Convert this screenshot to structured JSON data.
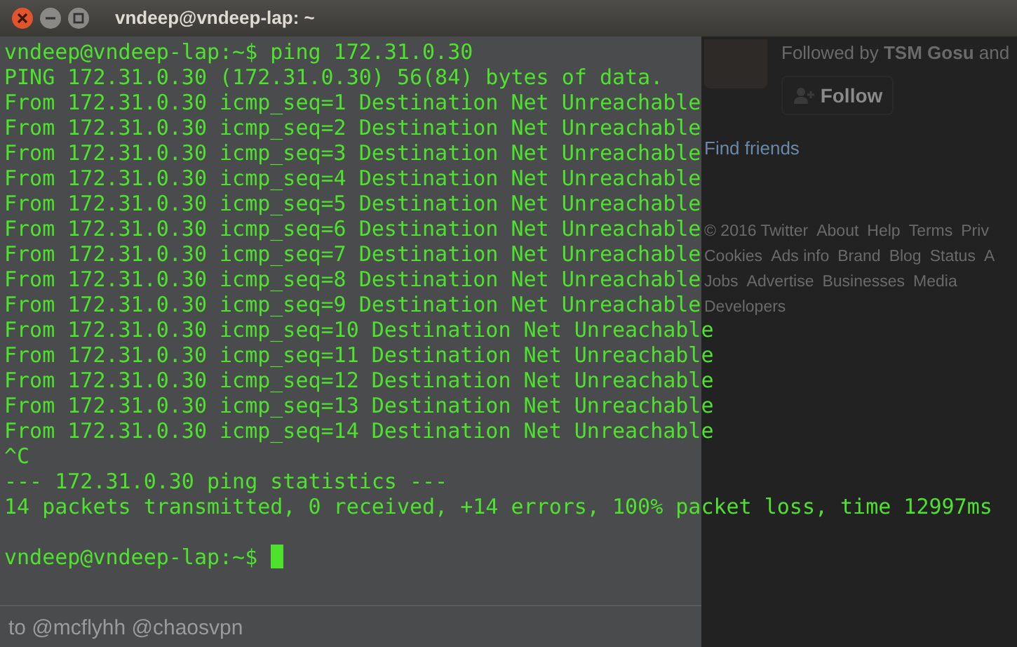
{
  "window": {
    "title": "vndeep@vndeep-lap: ~"
  },
  "terminal": {
    "lines": [
      {
        "kind": "prompt",
        "prompt": "vndeep@vndeep-lap:~$",
        "command": "ping 172.31.0.30",
        "cursor": false
      },
      {
        "kind": "output",
        "text": "PING 172.31.0.30 (172.31.0.30) 56(84) bytes of data."
      },
      {
        "kind": "output",
        "text": "From 172.31.0.30 icmp_seq=1 Destination Net Unreachable"
      },
      {
        "kind": "output",
        "text": "From 172.31.0.30 icmp_seq=2 Destination Net Unreachable"
      },
      {
        "kind": "output",
        "text": "From 172.31.0.30 icmp_seq=3 Destination Net Unreachable"
      },
      {
        "kind": "output",
        "text": "From 172.31.0.30 icmp_seq=4 Destination Net Unreachable"
      },
      {
        "kind": "output",
        "text": "From 172.31.0.30 icmp_seq=5 Destination Net Unreachable"
      },
      {
        "kind": "output",
        "text": "From 172.31.0.30 icmp_seq=6 Destination Net Unreachable"
      },
      {
        "kind": "output",
        "text": "From 172.31.0.30 icmp_seq=7 Destination Net Unreachable"
      },
      {
        "kind": "output",
        "text": "From 172.31.0.30 icmp_seq=8 Destination Net Unreachable"
      },
      {
        "kind": "output",
        "text": "From 172.31.0.30 icmp_seq=9 Destination Net Unreachable"
      },
      {
        "kind": "output",
        "text": "From 172.31.0.30 icmp_seq=10 Destination Net Unreachable"
      },
      {
        "kind": "output",
        "text": "From 172.31.0.30 icmp_seq=11 Destination Net Unreachable"
      },
      {
        "kind": "output",
        "text": "From 172.31.0.30 icmp_seq=12 Destination Net Unreachable"
      },
      {
        "kind": "output",
        "text": "From 172.31.0.30 icmp_seq=13 Destination Net Unreachable"
      },
      {
        "kind": "output",
        "text": "From 172.31.0.30 icmp_seq=14 Destination Net Unreachable"
      },
      {
        "kind": "output",
        "text": "^C"
      },
      {
        "kind": "output",
        "text": "--- 172.31.0.30 ping statistics ---"
      },
      {
        "kind": "output",
        "text": "14 packets transmitted, 0 received, +14 errors, 100% packet loss, time 12997ms"
      },
      {
        "kind": "blank"
      },
      {
        "kind": "prompt",
        "prompt": "vndeep@vndeep-lap:~$",
        "cursor": true
      }
    ]
  },
  "background_page": {
    "followed_by": "Followed by **TSM Gosu** and",
    "follow_button": "Follow",
    "find_friends": "Find friends",
    "footer_rows": [
      [
        "© 2016 Twitter",
        "About",
        "Help",
        "Terms",
        "Priv"
      ],
      [
        "Cookies",
        "Ads info",
        "Brand",
        "Blog",
        "Status",
        "A"
      ],
      [
        "Jobs",
        "Advertise",
        "Businesses",
        "Media"
      ],
      [
        "Developers"
      ]
    ],
    "reply_to": "to @mcflyhh @chaosvpn"
  }
}
